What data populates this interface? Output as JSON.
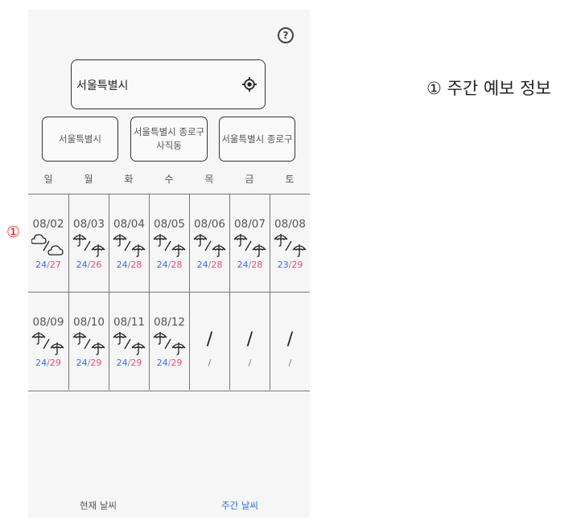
{
  "annotation": {
    "marker": "①",
    "label": "① 주간 예보 정보"
  },
  "header": {
    "help_symbol": "?"
  },
  "search": {
    "text": "서울특별시"
  },
  "recent_locations": [
    "서울특별시",
    "서울특별시 종로구 사직동",
    "서울특별시 종로구"
  ],
  "weekdays": [
    "일",
    "월",
    "화",
    "수",
    "목",
    "금",
    "토"
  ],
  "weeks": [
    [
      {
        "date": "08/02",
        "icon": "cloud-cloud-icon",
        "low": "24",
        "high": "27"
      },
      {
        "date": "08/03",
        "icon": "umbrella-umbrella-icon",
        "low": "24",
        "high": "26"
      },
      {
        "date": "08/04",
        "icon": "umbrella-umbrella-icon",
        "low": "24",
        "high": "28"
      },
      {
        "date": "08/05",
        "icon": "umbrella-umbrella-icon",
        "low": "24",
        "high": "28"
      },
      {
        "date": "08/06",
        "icon": "umbrella-umbrella-icon",
        "low": "24",
        "high": "28"
      },
      {
        "date": "08/07",
        "icon": "umbrella-umbrella-icon",
        "low": "24",
        "high": "28"
      },
      {
        "date": "08/08",
        "icon": "umbrella-umbrella-icon",
        "low": "23",
        "high": "29"
      }
    ],
    [
      {
        "date": "08/09",
        "icon": "umbrella-umbrella-icon",
        "low": "24",
        "high": "29"
      },
      {
        "date": "08/10",
        "icon": "umbrella-umbrella-icon",
        "low": "24",
        "high": "29"
      },
      {
        "date": "08/11",
        "icon": "umbrella-umbrella-icon",
        "low": "24",
        "high": "29"
      },
      {
        "date": "08/12",
        "icon": "umbrella-umbrella-icon",
        "low": "24",
        "high": "29"
      },
      {
        "date": "",
        "icon": "none",
        "slash": "/",
        "temp": "/"
      },
      {
        "date": "",
        "icon": "none",
        "slash": "/",
        "temp": "/"
      },
      {
        "date": "",
        "icon": "none",
        "slash": "/",
        "temp": "/"
      }
    ]
  ],
  "temp_separator": "/",
  "bottom_tabs": {
    "current": "현재 날씨",
    "weekly": "주간 날씨"
  },
  "colors": {
    "low_temp": "#3a6fd8",
    "high_temp": "#e0507a",
    "active_tab": "#2f6ee0",
    "marker": "#e0201f"
  }
}
